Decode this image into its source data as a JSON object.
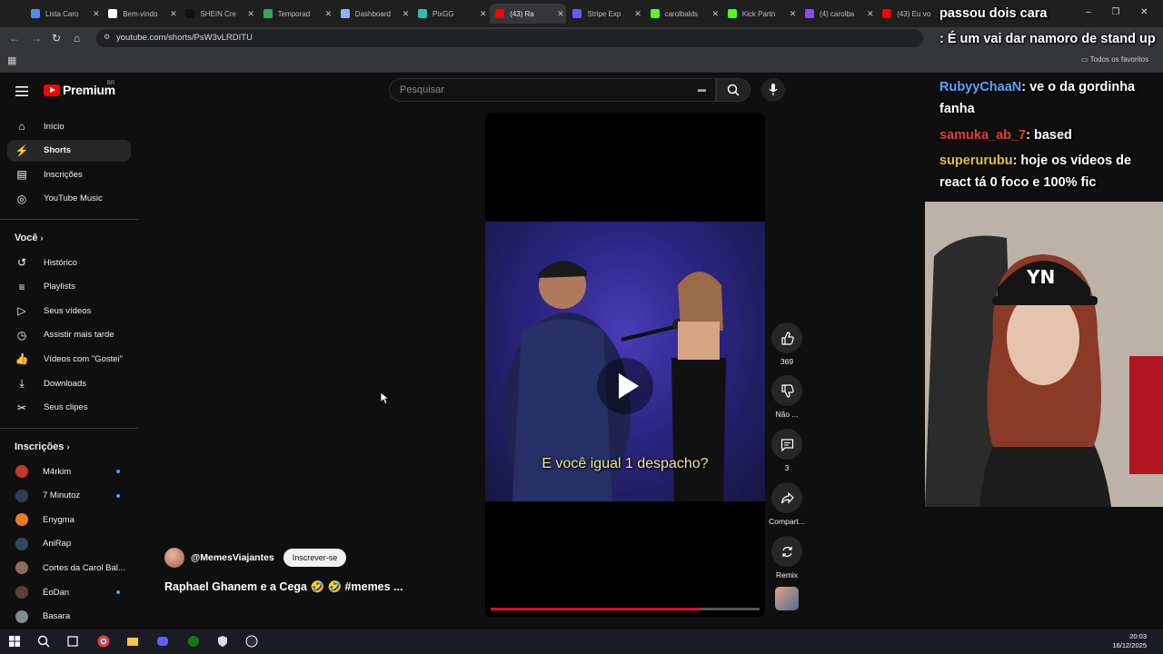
{
  "browser": {
    "tabs": [
      {
        "label": "Lista Caro",
        "icon": "globe-icon",
        "color": "#4b8bf5"
      },
      {
        "label": "Bem-vindo",
        "icon": "notion-icon",
        "color": "#ffffff"
      },
      {
        "label": "SHEIN Cre",
        "icon": "shein-icon",
        "color": "#111111"
      },
      {
        "label": "Temporad",
        "icon": "drive-icon",
        "color": "#34a853"
      },
      {
        "label": "Dashboard",
        "icon": "globe-icon",
        "color": "#8ab4f8"
      },
      {
        "label": "PixGG",
        "icon": "pixgg-icon",
        "color": "#32bcad"
      },
      {
        "label": "(43) Ra",
        "icon": "youtube-icon",
        "color": "#ff0000"
      },
      {
        "label": "Stripe Exp",
        "icon": "stripe-icon",
        "color": "#635bff"
      },
      {
        "label": "carolbalds",
        "icon": "kick-icon",
        "color": "#53fc18"
      },
      {
        "label": "Kick Partn",
        "icon": "kick-icon",
        "color": "#53fc18"
      },
      {
        "label": "(4) carolba",
        "icon": "twitch-icon",
        "color": "#9146ff"
      },
      {
        "label": "(43) Eu vo",
        "icon": "youtube-icon",
        "color": "#ff0000"
      }
    ],
    "url": "youtube.com/shorts/PsW3vLRDITU",
    "bookmarks_label": "Todos os favoritos"
  },
  "youtube": {
    "logo_word": "Premium",
    "country": "BR",
    "search_placeholder": "Pesquisar",
    "nav": [
      {
        "label": "Início",
        "icon": "home-icon"
      },
      {
        "label": "Shorts",
        "icon": "shorts-icon",
        "active": true
      },
      {
        "label": "Inscrições",
        "icon": "subscriptions-icon"
      },
      {
        "label": "YouTube Music",
        "icon": "music-icon"
      }
    ],
    "you_header": "Você",
    "you_items": [
      {
        "label": "Histórico",
        "icon": "history-icon"
      },
      {
        "label": "Playlists",
        "icon": "playlists-icon"
      },
      {
        "label": "Seus vídeos",
        "icon": "your-videos-icon"
      },
      {
        "label": "Assistir mais tarde",
        "icon": "watch-later-icon"
      },
      {
        "label": "Vídeos com \"Gostei\"",
        "icon": "liked-icon"
      },
      {
        "label": "Downloads",
        "icon": "download-icon"
      },
      {
        "label": "Seus clipes",
        "icon": "clips-icon"
      }
    ],
    "subs_header": "Inscrições",
    "subscriptions": [
      {
        "label": "M4rkim",
        "color": "#c0392b",
        "new": true
      },
      {
        "label": "7 Minutoz",
        "color": "#2c3e50",
        "new": true
      },
      {
        "label": "Enygma",
        "color": "#e67e22",
        "new": false
      },
      {
        "label": "AniRap",
        "color": "#34495e",
        "new": false
      },
      {
        "label": "Cortes da Carol Bal...",
        "color": "#8e6b5a",
        "new": false
      },
      {
        "label": "ÉoDan",
        "color": "#5d4037",
        "new": true
      },
      {
        "label": "Basara",
        "color": "#7f8c8d",
        "new": false
      }
    ],
    "short": {
      "caption": "E você igual 1 despacho?",
      "channel": "@MemesViajantes",
      "subscribe_label": "Inscrever-se",
      "title": "Raphael Ghanem e a Cega 🤣 🤣 #memes ...",
      "progress": 0.78,
      "actions": [
        {
          "icon": "like-icon",
          "label": "369"
        },
        {
          "icon": "dislike-icon",
          "label": "Não ..."
        },
        {
          "icon": "comment-icon",
          "label": "3"
        },
        {
          "icon": "share-icon",
          "label": "Compart..."
        },
        {
          "icon": "remix-icon",
          "label": "Remix"
        }
      ]
    }
  },
  "stream_chat": [
    {
      "name": "",
      "text": "passou dois cara",
      "name_color": "#ffffff"
    },
    {
      "name": "",
      "text": ": É um vai dar namoro de stand up",
      "name_color": "#1e1ea8"
    },
    {
      "name": "RubyyChaaN",
      "text": ": ve o da gordinha fanha",
      "name_color": "#5aa9ff"
    },
    {
      "name": "samuka_ab_7",
      "text": ": based",
      "name_color": "#e0413c"
    },
    {
      "name": "superurubu",
      "text": ": hoje os vídeos de react tá 0 foco e 100% fic",
      "name_color": "#e5c53b"
    }
  ],
  "taskbar": {
    "time": "20:03",
    "date": "16/12/2025"
  }
}
